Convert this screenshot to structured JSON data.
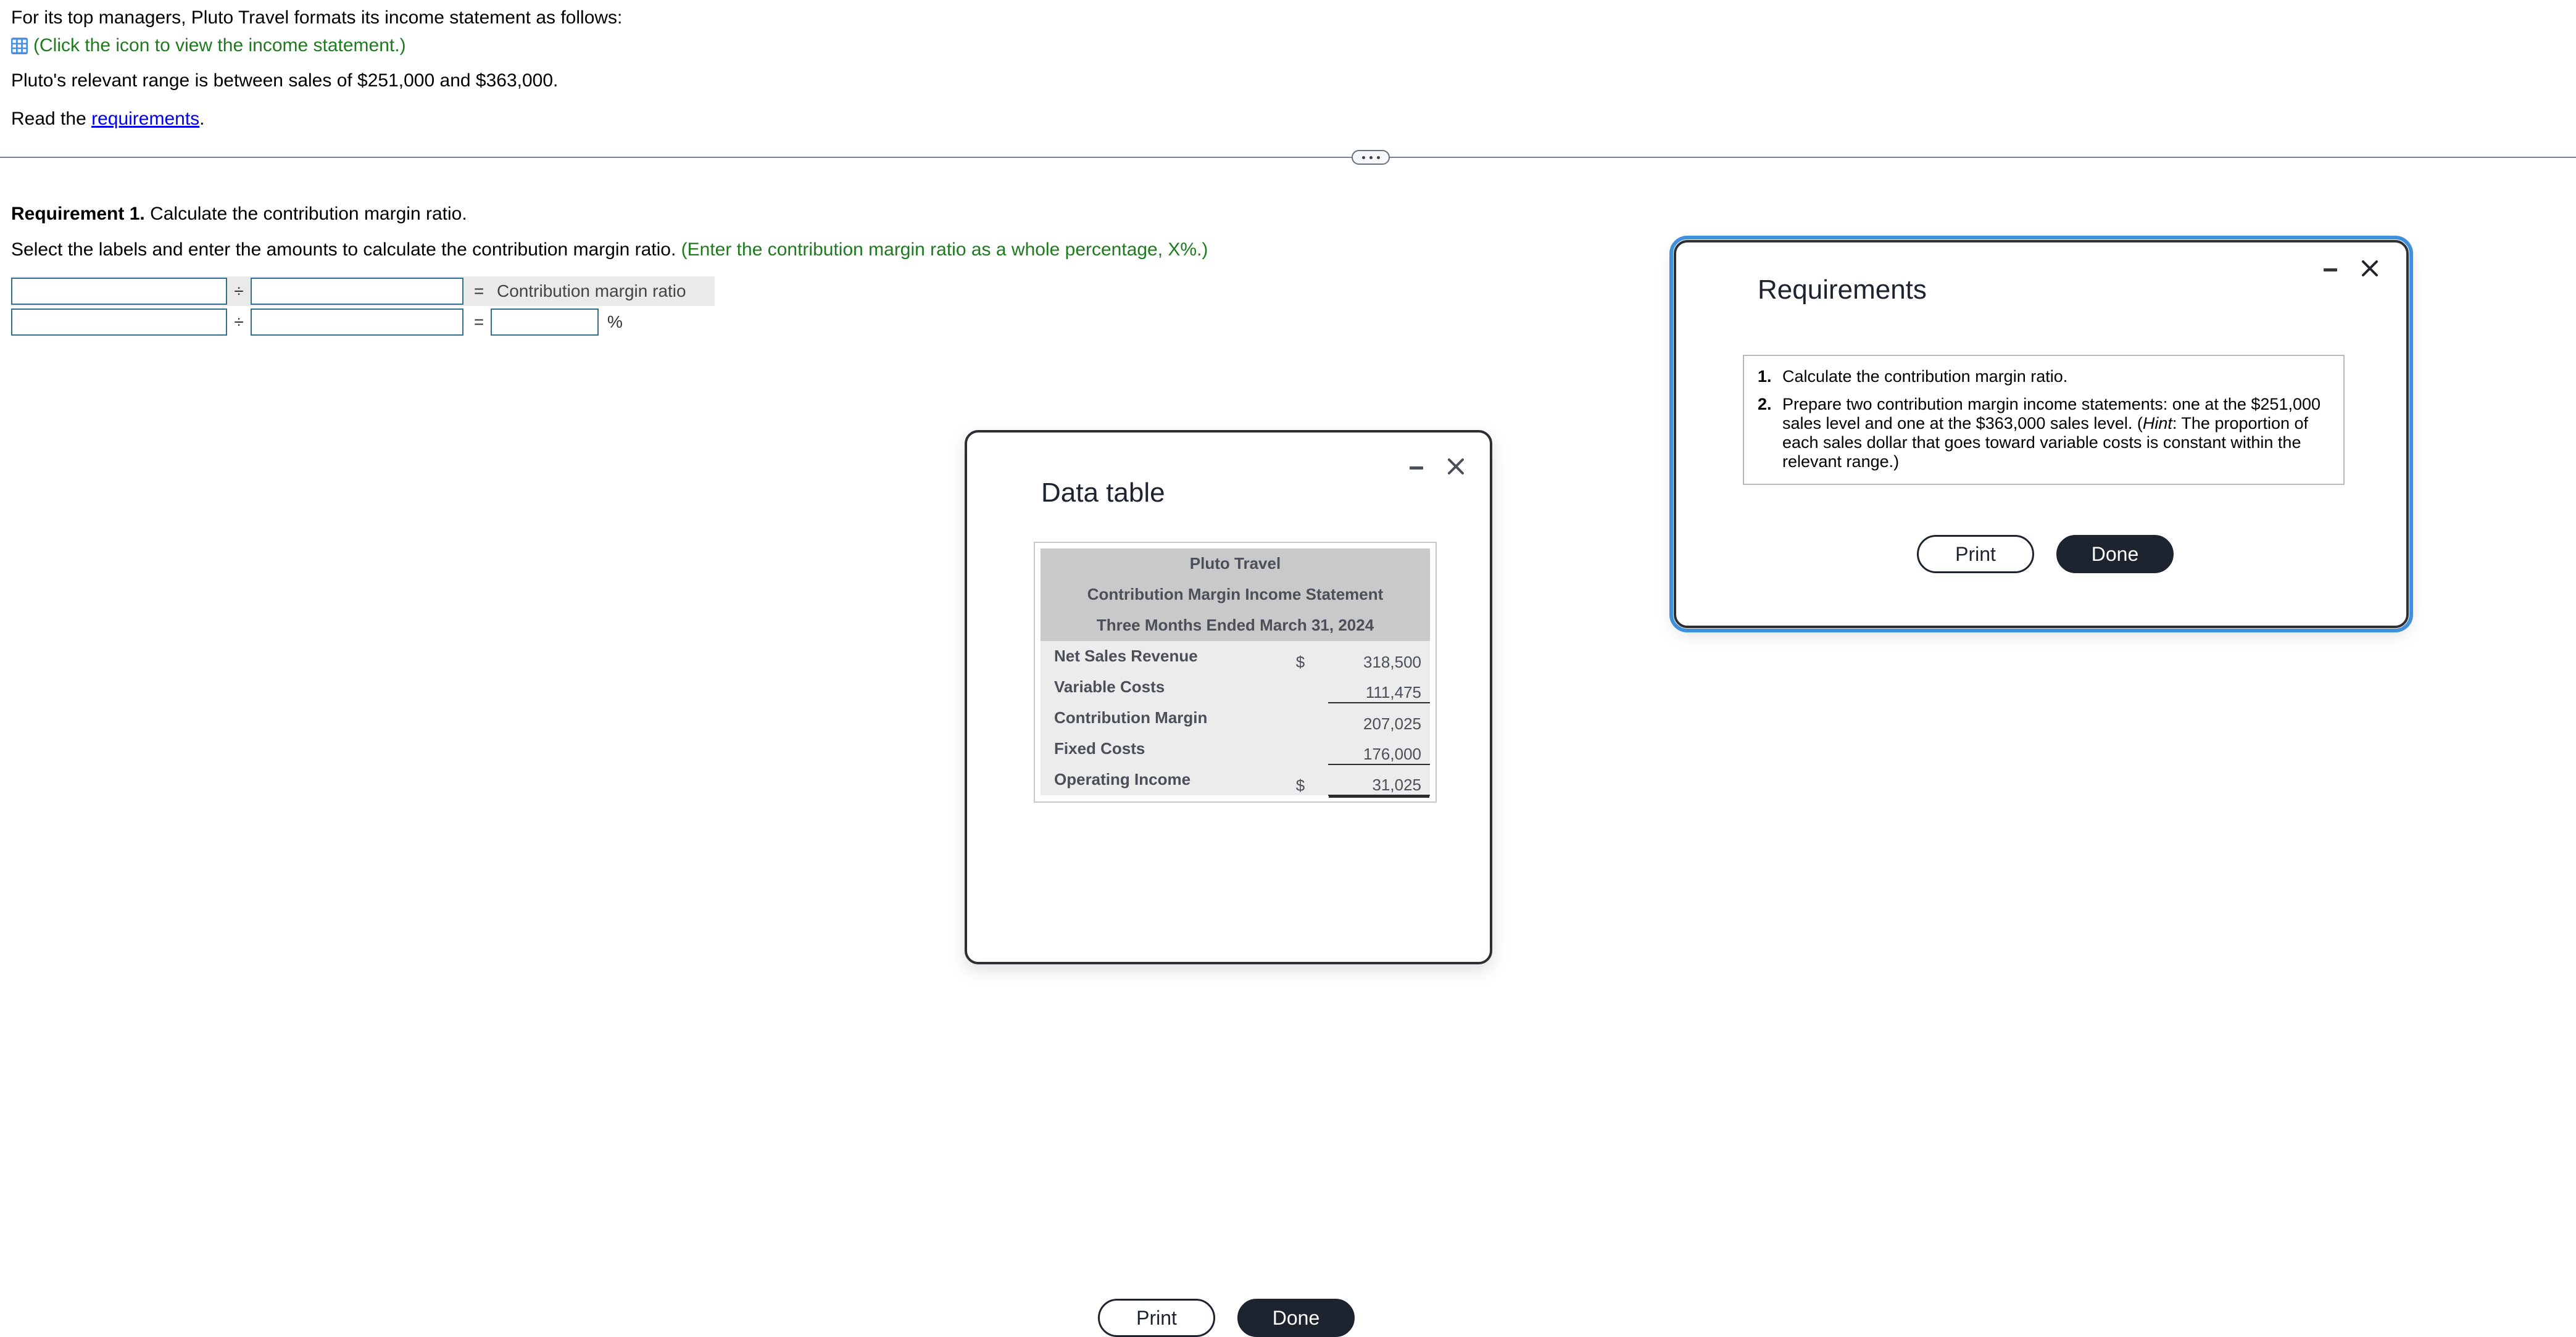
{
  "problem": {
    "line1": "For its top managers, Pluto Travel formats its income statement as follows:",
    "icon_name": "table-grid-icon",
    "icon_note": "(Click the icon to view the income statement.)",
    "line3": "Pluto's relevant range is between sales of $251,000 and $363,000.",
    "read_prefix": "Read the ",
    "read_link": "requirements",
    "read_suffix": "."
  },
  "splitter": {
    "handle_name": "splitter-handle-dots"
  },
  "requirement1": {
    "heading_bold": "Requirement 1.",
    "heading_rest": " Calculate the contribution margin ratio.",
    "instruction": "Select the labels and enter the amounts to calculate the contribution margin ratio. ",
    "instruction_green": "(Enter the contribution margin ratio as a whole percentage, X%.)",
    "rows": [
      {
        "label_input_value": "",
        "amount_input_value": "",
        "operator": "÷",
        "equals": "=",
        "result_label": "Contribution margin ratio",
        "shaded": true
      },
      {
        "label_input_value": "",
        "amount_input_value": "",
        "operator": "÷",
        "equals": "=",
        "result_value": "",
        "percent_sign": "%",
        "shaded": false
      }
    ]
  },
  "data_table_dialog": {
    "title": "Data table",
    "minimize_label": "minimize",
    "close_label": "close",
    "print_label": "Print",
    "done_label": "Done",
    "statement": {
      "header_lines": [
        "Pluto Travel",
        "Contribution Margin Income Statement",
        "Three Months Ended March 31, 2024"
      ],
      "rows": [
        {
          "label": "Net Sales Revenue",
          "currency": "$",
          "amount": "318,500",
          "rule": "none"
        },
        {
          "label": "Variable Costs",
          "currency": "",
          "amount": "111,475",
          "rule": "single"
        },
        {
          "label": "Contribution Margin",
          "currency": "",
          "amount": "207,025",
          "rule": "none"
        },
        {
          "label": "Fixed Costs",
          "currency": "",
          "amount": "176,000",
          "rule": "single"
        },
        {
          "label": "Operating Income",
          "currency": "$",
          "amount": "31,025",
          "rule": "double"
        }
      ]
    }
  },
  "requirements_dialog": {
    "title": "Requirements",
    "minimize_label": "minimize",
    "close_label": "close",
    "print_label": "Print",
    "done_label": "Done",
    "items": [
      {
        "number": "1.",
        "text_parts": [
          {
            "text": "Calculate the contribution margin ratio.",
            "italic": false
          }
        ]
      },
      {
        "number": "2.",
        "text_parts": [
          {
            "text": "Prepare two contribution margin income statements: one at the $251,000 sales level and one at the $363,000 sales level. (",
            "italic": false
          },
          {
            "text": "Hint",
            "italic": true
          },
          {
            "text": ": The proportion of each sales dollar that goes toward variable costs is constant within the relevant range.)",
            "italic": false
          }
        ]
      }
    ]
  },
  "colors": {
    "green_note": "#1f7a1f",
    "link_blue": "#0000ee",
    "input_border": "#35718f",
    "shade_band": "#eaeaea",
    "dialog_border": "#2c2f33",
    "focus_ring": "#3f90dd",
    "stmt_header_bg": "#c9c9c9",
    "stmt_body_bg": "#ececec",
    "done_button_bg": "#1d2430"
  }
}
